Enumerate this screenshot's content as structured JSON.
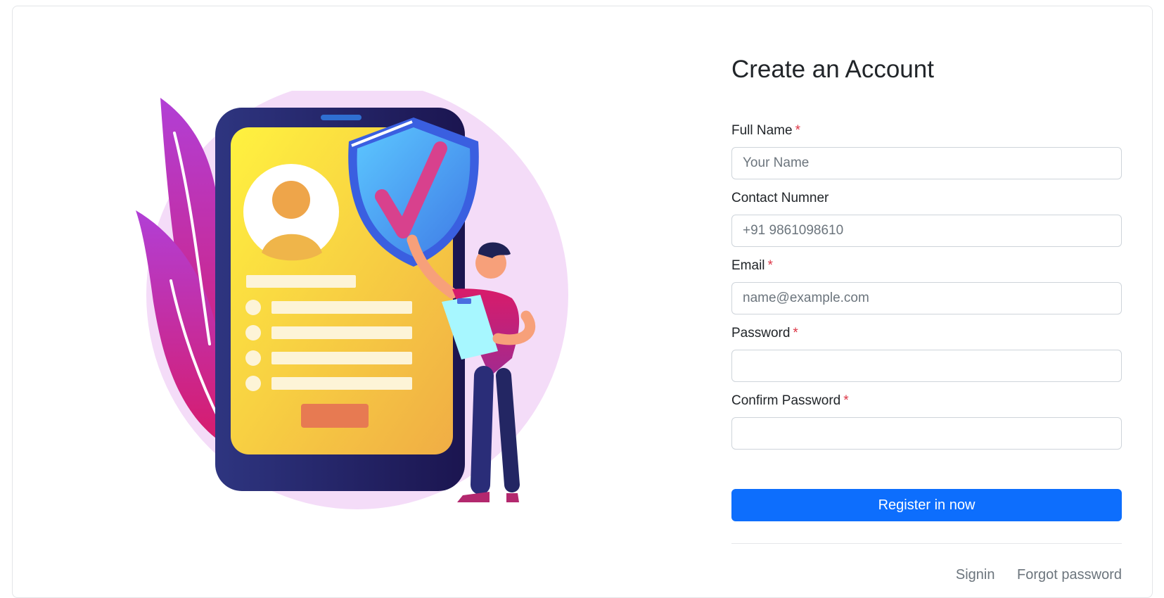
{
  "form": {
    "title": "Create an Account",
    "fields": [
      {
        "label": "Full Name",
        "required": true,
        "placeholder": "Your Name",
        "value": ""
      },
      {
        "label": "Contact Numner",
        "required": false,
        "placeholder": "+91 9861098610",
        "value": ""
      },
      {
        "label": "Email",
        "required": true,
        "placeholder": "name@example.com",
        "value": ""
      },
      {
        "label": "Password",
        "required": true,
        "placeholder": "",
        "value": ""
      },
      {
        "label": "Confirm Password",
        "required": true,
        "placeholder": "",
        "value": ""
      }
    ],
    "required_marker": "*",
    "submit_label": "Register in now",
    "links": {
      "signin": "Signin",
      "forgot": "Forgot password"
    }
  },
  "colors": {
    "primary": "#0d6efd",
    "required": "#dc3545",
    "muted": "#6c757d"
  },
  "illustration": {
    "subject": "person-next-to-phone-with-profile-and-security-shield"
  }
}
